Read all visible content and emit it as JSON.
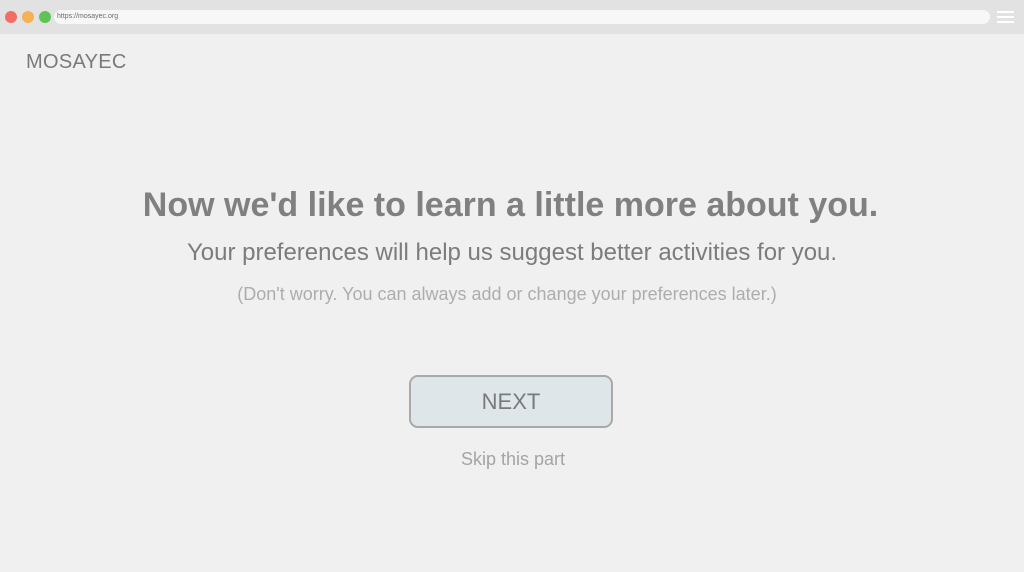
{
  "browser": {
    "url": "https://mosayec.org",
    "icons": {
      "close": "red-dot-icon",
      "minimize": "yellow-dot-icon",
      "maximize": "green-dot-icon",
      "menu": "hamburger-menu-icon"
    }
  },
  "header": {
    "logo": "MOSAYEC"
  },
  "main": {
    "headline": "Now we'd like to learn a little more about you.",
    "subhead": "Your preferences will help us suggest better activities for you.",
    "note": "(Don't worry. You can always add or change your preferences later.)",
    "next_label": "NEXT",
    "skip_label": "Skip this part"
  },
  "colors": {
    "background": "#f0f0f0",
    "button_bg": "#dfe6ea",
    "button_border": "#a9a9a9",
    "text_primary": "#808080",
    "text_muted": "#adadad"
  }
}
